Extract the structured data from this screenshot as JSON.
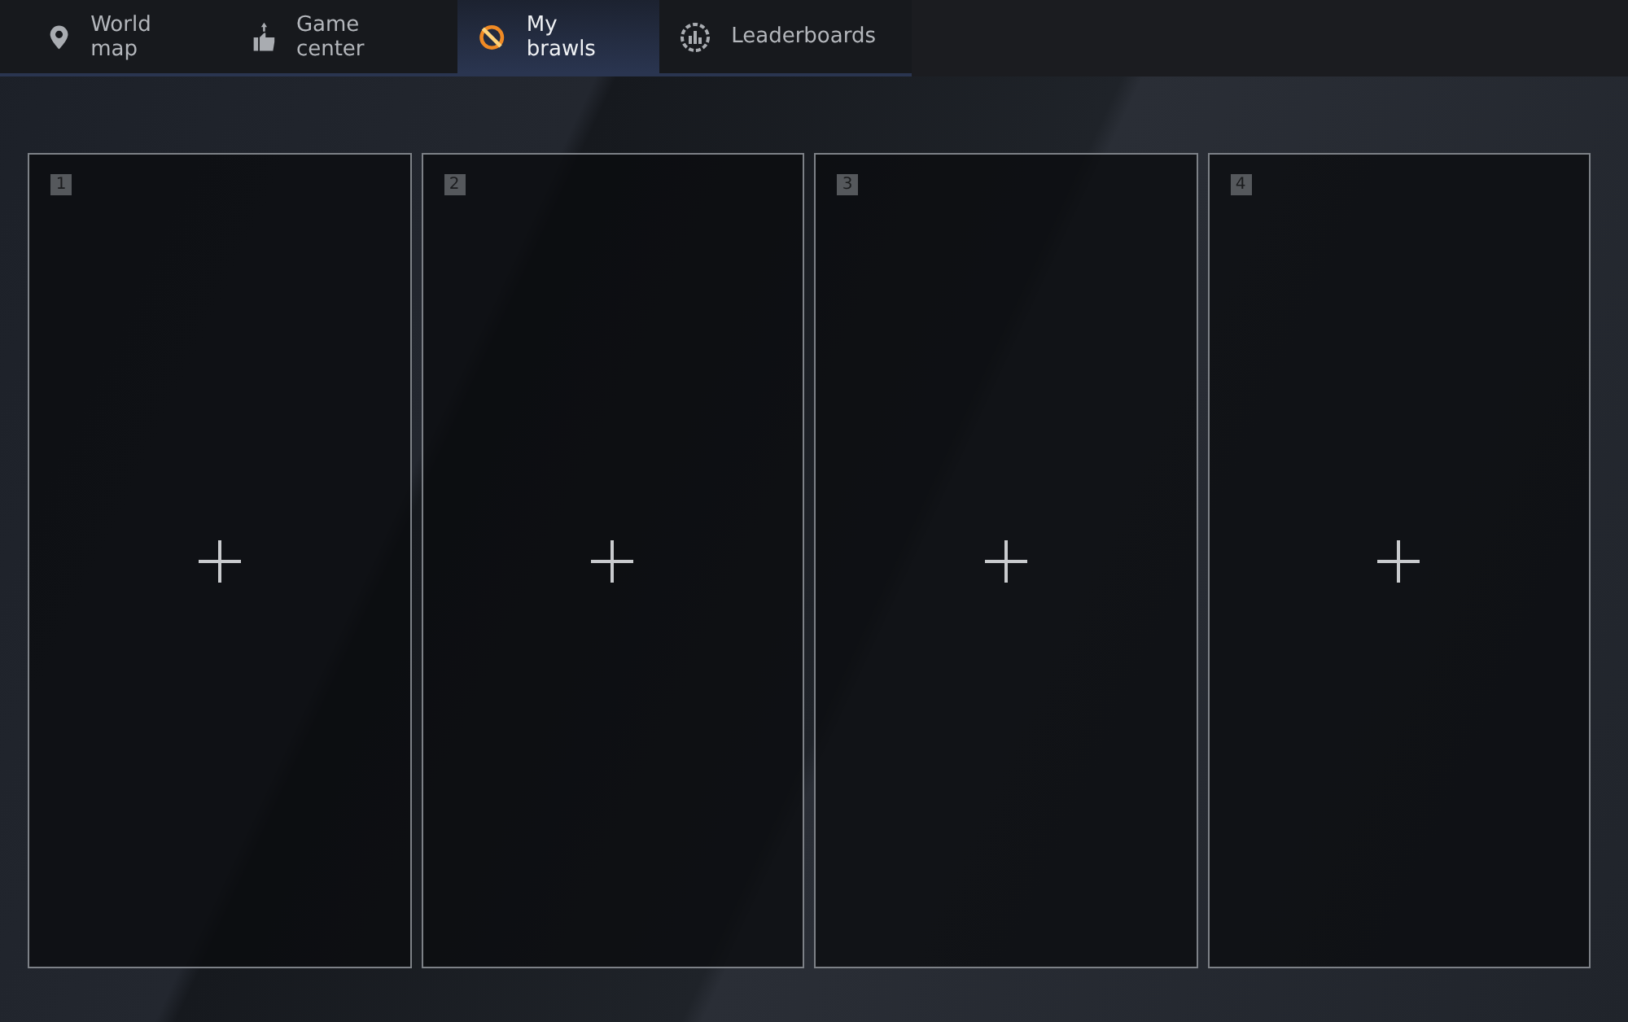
{
  "tabs": [
    {
      "kind": "map",
      "label": "World map",
      "selected": false
    },
    {
      "kind": "game",
      "label": "Game center",
      "selected": false
    },
    {
      "kind": "brawl",
      "label": "My brawls",
      "selected": true
    },
    {
      "kind": "board",
      "label": "Leaderboards",
      "selected": false
    }
  ],
  "slots": [
    {
      "number": "1"
    },
    {
      "number": "2"
    },
    {
      "number": "3"
    },
    {
      "number": "4"
    }
  ]
}
